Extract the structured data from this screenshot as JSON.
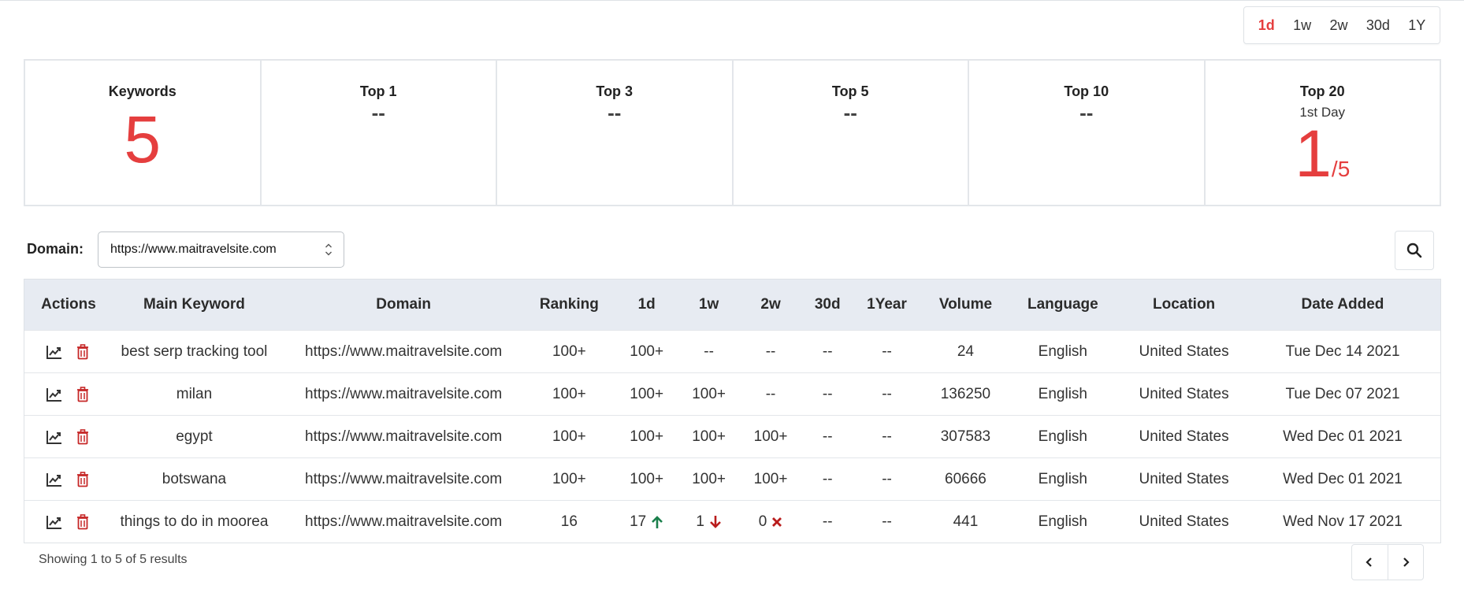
{
  "periods": [
    "1d",
    "1w",
    "2w",
    "30d",
    "1Y"
  ],
  "active_period": "1d",
  "stats": {
    "keywords": {
      "title": "Keywords",
      "value": "5"
    },
    "top1": {
      "title": "Top 1",
      "value": "--"
    },
    "top3": {
      "title": "Top 3",
      "value": "--"
    },
    "top5": {
      "title": "Top 5",
      "value": "--"
    },
    "top10": {
      "title": "Top 10",
      "value": "--"
    },
    "top20": {
      "title": "Top 20",
      "subtitle": "1st Day",
      "value": "1",
      "total": "/5"
    }
  },
  "domain_filter": {
    "label": "Domain:",
    "value": "https://www.maitravelsite.com"
  },
  "table": {
    "headers": {
      "actions": "Actions",
      "keyword": "Main Keyword",
      "domain": "Domain",
      "ranking": "Ranking",
      "d1": "1d",
      "w1": "1w",
      "w2": "2w",
      "d30": "30d",
      "y1": "1Year",
      "volume": "Volume",
      "language": "Language",
      "location": "Location",
      "date_added": "Date Added"
    },
    "rows": [
      {
        "keyword": "best serp tracking tool",
        "domain": "https://www.maitravelsite.com",
        "ranking": "100+",
        "d1": "100+",
        "w1": "--",
        "w2": "--",
        "d30": "--",
        "y1": "--",
        "volume": "24",
        "language": "English",
        "location": "United States",
        "date_added": "Tue Dec 14 2021"
      },
      {
        "keyword": "milan",
        "domain": "https://www.maitravelsite.com",
        "ranking": "100+",
        "d1": "100+",
        "w1": "100+",
        "w2": "--",
        "d30": "--",
        "y1": "--",
        "volume": "136250",
        "language": "English",
        "location": "United States",
        "date_added": "Tue Dec 07 2021"
      },
      {
        "keyword": "egypt",
        "domain": "https://www.maitravelsite.com",
        "ranking": "100+",
        "d1": "100+",
        "w1": "100+",
        "w2": "100+",
        "d30": "--",
        "y1": "--",
        "volume": "307583",
        "language": "English",
        "location": "United States",
        "date_added": "Wed Dec 01 2021"
      },
      {
        "keyword": "botswana",
        "domain": "https://www.maitravelsite.com",
        "ranking": "100+",
        "d1": "100+",
        "w1": "100+",
        "w2": "100+",
        "d30": "--",
        "y1": "--",
        "volume": "60666",
        "language": "English",
        "location": "United States",
        "date_added": "Wed Dec 01 2021"
      },
      {
        "keyword": "things to do in moorea",
        "domain": "https://www.maitravelsite.com",
        "ranking": "16",
        "d1": "17",
        "w1": "1",
        "w2": "0",
        "d30": "--",
        "y1": "--",
        "volume": "441",
        "language": "English",
        "location": "United States",
        "date_added": "Wed Nov 17 2021"
      }
    ]
  },
  "trend_icons": {
    "up": "arrow-up-icon",
    "down": "arrow-down-icon",
    "lost": "x-mark-icon"
  },
  "colors": {
    "accent": "#e53e3e",
    "up": "#1a7f4b",
    "down": "#b91c1c",
    "header_bg": "#e7ebf2"
  },
  "footer": {
    "showing": "Showing 1 to 5 of 5 results"
  }
}
